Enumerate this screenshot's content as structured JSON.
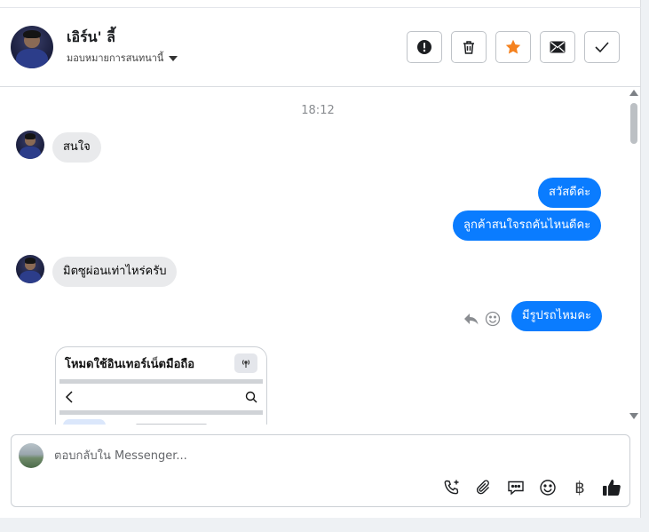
{
  "header": {
    "name": "เอิร์น' ลี้",
    "subtitle": "มอบหมายการสนทนานี้",
    "actions": [
      {
        "icon": "alert-icon"
      },
      {
        "icon": "trash-icon"
      },
      {
        "icon": "star-icon",
        "color": "#f5821f"
      },
      {
        "icon": "mail-icon"
      },
      {
        "icon": "check-icon"
      }
    ]
  },
  "chat": {
    "timestamp": "18:12",
    "messages": [
      {
        "direction": "in",
        "text": "สนใจ"
      },
      {
        "direction": "out",
        "text": "สวัสดีค่ะ"
      },
      {
        "direction": "out",
        "text": "ลูกค้าสนใจรถคันไหนดีคะ"
      },
      {
        "direction": "in",
        "text": "มิตซูผ่อนเท่าไหร่ครับ"
      },
      {
        "direction": "out",
        "text": "มีรูปรถไหมคะ"
      }
    ],
    "card": {
      "title": "โหมดใช้อินเทอร์เน็ตมือถือ"
    }
  },
  "composer": {
    "placeholder": "ตอบกลับใน Messenger..."
  },
  "colors": {
    "accent": "#0a7cff",
    "incoming_bubble": "#e9eaec"
  }
}
